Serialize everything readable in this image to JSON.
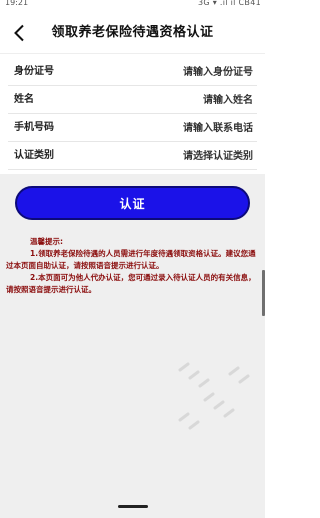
{
  "status_bar": {
    "time": "19:21",
    "right": "3G ▾ .ıl ıl CB41"
  },
  "header": {
    "title": "领取养老保险待遇资格认证"
  },
  "form": {
    "fields": [
      {
        "label": "身份证号",
        "placeholder": "请输入身份证号"
      },
      {
        "label": "姓名",
        "placeholder": "请输入姓名"
      },
      {
        "label": "手机号码",
        "placeholder": "请输入联系电话"
      },
      {
        "label": "认证类别",
        "placeholder": "请选择认证类别"
      }
    ]
  },
  "verify_button": {
    "label": "认证"
  },
  "notice": {
    "title": "温馨提示:",
    "lines": [
      "1.领取养老保险待遇的人员需进行年度待遇领取资格认证。建议您通过本页面自助认证，请按照语音提示进行认证。",
      "2.本页面可为他人代办认证，您可通过录入待认证人员的有关信息，请按照语音提示进行认证。"
    ]
  },
  "colors": {
    "button": "#1b12e8",
    "notice_text": "#8b0d0d",
    "lower_background": "#efefef"
  }
}
